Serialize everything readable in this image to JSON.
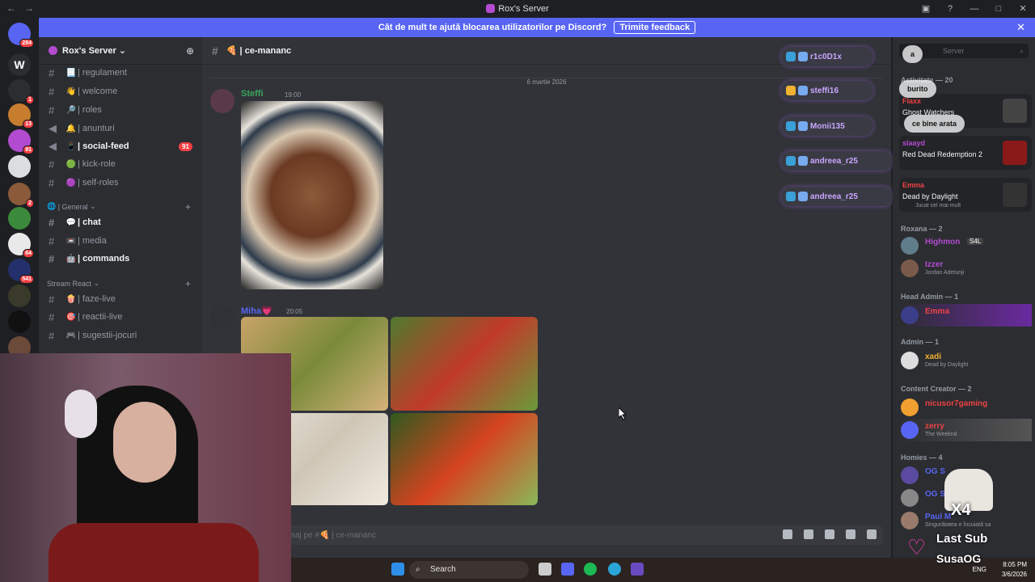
{
  "window": {
    "title": "Rox's Server"
  },
  "banner": {
    "text": "Cât de mult te ajută blocarea utilizatorilor pe Discord?",
    "feedback_label": "Trimite feedback"
  },
  "guild_badges": {
    "g1": "284",
    "g2": "1",
    "g3": "13",
    "g4": "91",
    "g5": "2",
    "g6": "64",
    "g7": "541"
  },
  "server": {
    "name": "Rox's Server",
    "channels": [
      {
        "name": "| regulament",
        "emoji": "📃"
      },
      {
        "name": "| welcome",
        "emoji": "👋"
      },
      {
        "name": "| roles",
        "emoji": "🔎"
      },
      {
        "name": "| anunturi",
        "emoji": "🔔"
      },
      {
        "name": "| social-feed",
        "emoji": "📱",
        "unread": "91"
      },
      {
        "name": "| kick-role",
        "emoji": "🟢"
      },
      {
        "name": "| self-roles",
        "emoji": "🟣"
      }
    ],
    "category_general": "| General",
    "general_channels": [
      {
        "name": "| chat",
        "emoji": "💬"
      },
      {
        "name": "| media",
        "emoji": "📼"
      },
      {
        "name": "| commands",
        "emoji": "🤖"
      }
    ],
    "category_stream": "Stream React",
    "stream_channels": [
      {
        "name": "| faze-live",
        "emoji": "🍿"
      },
      {
        "name": "| reactii-live",
        "emoji": "🎯"
      },
      {
        "name": "| sugestii-jocuri",
        "emoji": "🎮"
      }
    ]
  },
  "chat": {
    "channel_name": "ce-mananc",
    "channel_emoji": "🍕",
    "date_separator": "6 martie 2026",
    "messages": [
      {
        "author": "Steffi",
        "time": "19:00",
        "color": "#3ba55c"
      },
      {
        "author": "Miha💗",
        "time": "20:05",
        "color": "#5865f2"
      }
    ],
    "input_placeholder": "saj pe #🍕 | ce-mananc"
  },
  "overlay_users": [
    {
      "name": "r1c0D1x"
    },
    {
      "name": "steffi16"
    },
    {
      "name": "Monii135"
    },
    {
      "name": "andreea_r25"
    },
    {
      "name": "andreea_r25"
    }
  ],
  "members": {
    "search_placeholder": "Server",
    "activity_label": "Activitate — 20",
    "activities": [
      {
        "name": "Flaxx",
        "game": "Ghost Watchers"
      },
      {
        "name": "slaayd",
        "game": "Red Dead Redemption 2"
      },
      {
        "name": "Emma",
        "game": "Dead by Daylight",
        "status": "Jucat cel mai mult"
      }
    ],
    "groups": [
      {
        "label": "Roxana — 2",
        "members": [
          {
            "name": "Highmon",
            "tag": "S4L",
            "color": "#b34bd1",
            "status": ""
          },
          {
            "name": "Izzer",
            "color": "#b34bd1",
            "status": "Jordan Adetunji"
          }
        ]
      },
      {
        "label": "Head Admin — 1",
        "members": [
          {
            "name": "Emma",
            "color": "#ed4245",
            "status": ""
          }
        ]
      },
      {
        "label": "Admin — 1",
        "members": [
          {
            "name": "xadi",
            "color": "#f0b232",
            "status": "Dead by Daylight"
          }
        ]
      },
      {
        "label": "Content Creator — 2",
        "members": [
          {
            "name": "nicusor7gaming",
            "color": "#ed4245",
            "status": ""
          },
          {
            "name": "zerry",
            "color": "#ed4245",
            "status": "The Weeknd"
          }
        ]
      },
      {
        "label": "Homies — 4",
        "members": [
          {
            "name": "OG S",
            "color": "#5865f2",
            "status": ""
          },
          {
            "name": "OG S",
            "color": "#5865f2",
            "status": ""
          },
          {
            "name": "Paul M",
            "color": "#5865f2",
            "status": "Singurătatea e încuiată sa"
          }
        ]
      }
    ]
  },
  "chat_bubbles": [
    "a",
    "burito",
    "ce bine arata"
  ],
  "sub_alert": {
    "multiplier": "X4",
    "line1": "Last Sub",
    "line2": "SusaOG"
  },
  "taskbar": {
    "search_label": "Search",
    "lang": "ENG",
    "time": "8:05 PM",
    "date": "3/6/2026"
  }
}
